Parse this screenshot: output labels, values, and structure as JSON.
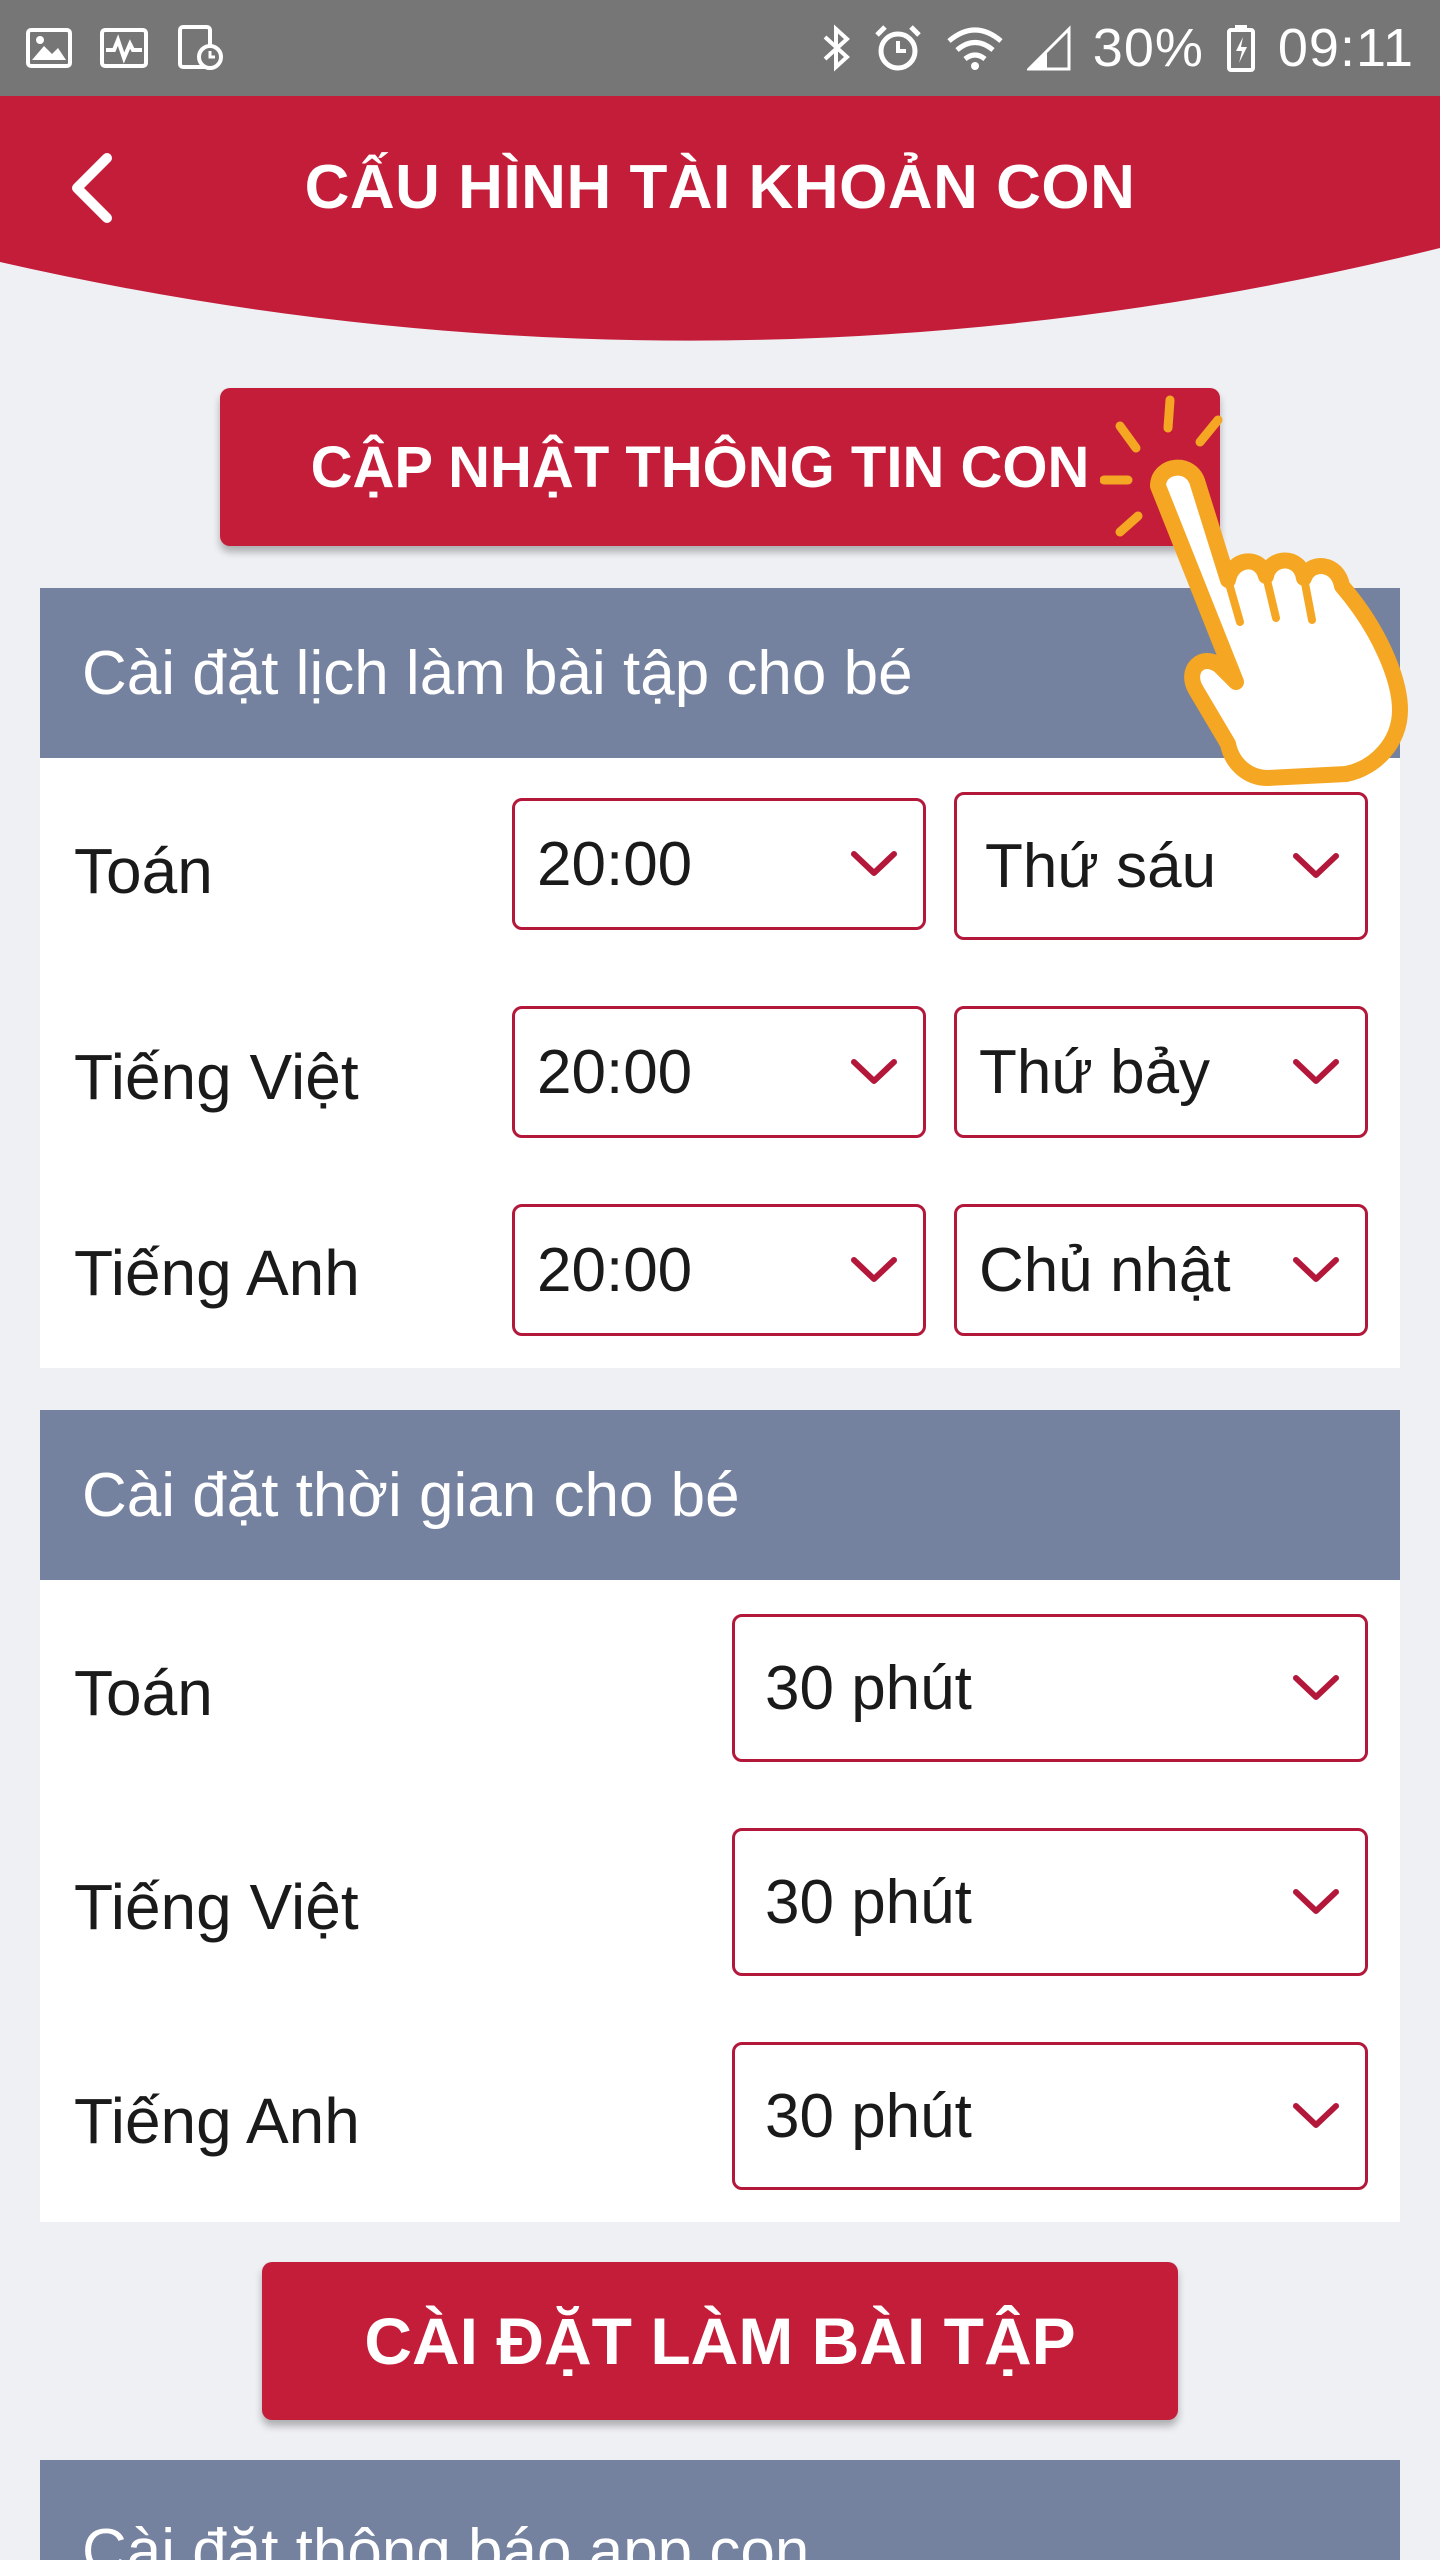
{
  "status_bar": {
    "battery_percent": "30%",
    "time": "09:11",
    "icons": [
      "image-icon",
      "activity-icon",
      "screen-clock-icon",
      "bluetooth-icon",
      "alarm-icon",
      "wifi-icon",
      "signal-icon",
      "battery-icon"
    ]
  },
  "header": {
    "title": "CẤU HÌNH TÀI KHOẢN CON",
    "back_icon": "chevron-left-icon",
    "color": "#c41d3a"
  },
  "update_button": {
    "label": "CẬP NHẬT THÔNG TIN CON"
  },
  "schedule_section": {
    "title": "Cài đặt lịch làm bài tập cho bé",
    "rows": [
      {
        "subject": "Toán",
        "time": "20:00",
        "day": "Thứ sáu"
      },
      {
        "subject": "Tiếng Việt",
        "time": "20:00",
        "day": "Thứ bảy"
      },
      {
        "subject": "Tiếng Anh",
        "time": "20:00",
        "day": "Chủ nhật"
      }
    ]
  },
  "duration_section": {
    "title": "Cài đặt thời gian cho bé",
    "rows": [
      {
        "subject": "Toán",
        "duration": "30 phút"
      },
      {
        "subject": "Tiếng Việt",
        "duration": "30 phút"
      },
      {
        "subject": "Tiếng Anh",
        "duration": "30 phút"
      }
    ]
  },
  "homework_button": {
    "label": "CÀI ĐẶT LÀM BÀI TẬP"
  },
  "notification_section": {
    "title": "Cài đặt thông báo app con"
  },
  "colors": {
    "accent": "#c41d3a",
    "section_header": "#74819f",
    "background": "#eff0f4",
    "hand_outline": "#f5a623"
  }
}
